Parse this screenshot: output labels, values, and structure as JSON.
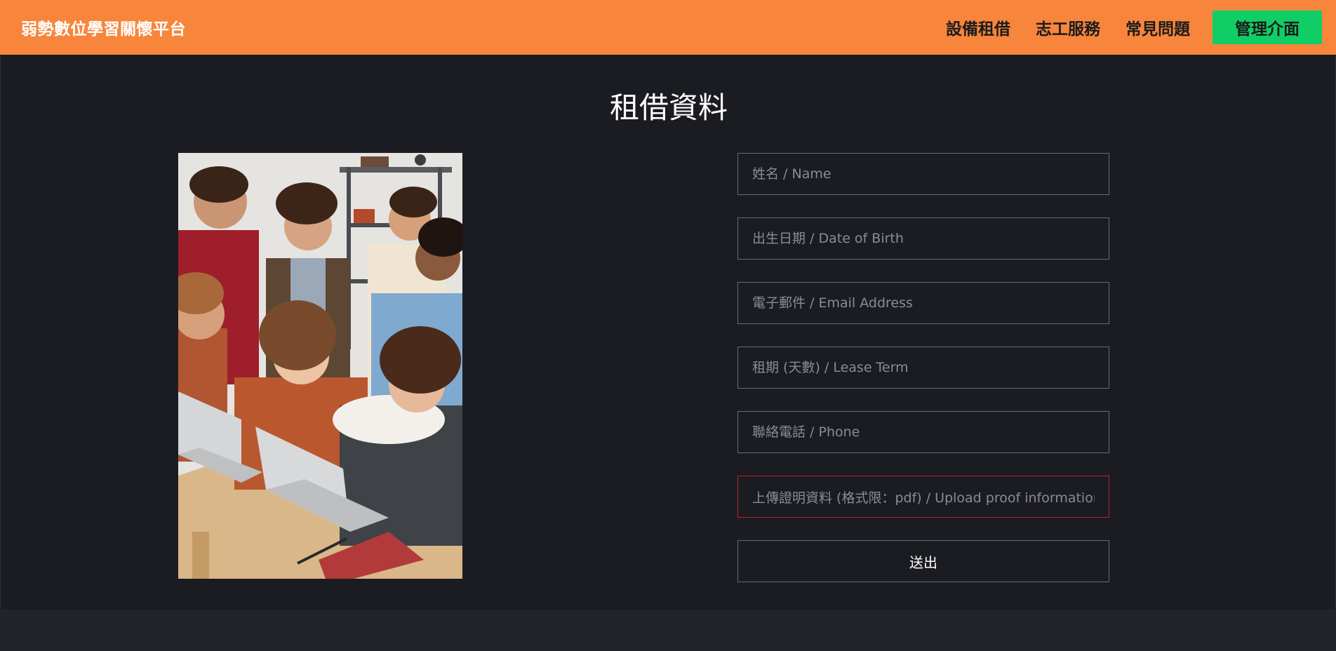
{
  "navbar": {
    "brand": "弱勢數位學習關懷平台",
    "links": [
      "設備租借",
      "志工服務",
      "常見問題"
    ],
    "admin_label": "管理介面"
  },
  "main": {
    "title": "租借資料",
    "form": {
      "name_placeholder": "姓名 / Name",
      "dob_placeholder": "出生日期 / Date of Birth",
      "email_placeholder": "電子郵件 / Email Address",
      "lease_placeholder": "租期 (天數) / Lease Term",
      "phone_placeholder": "聯絡電話 / Phone",
      "upload_label": "上傳證明資料 (格式限：pdf) / Upload proof information (",
      "submit_label": "送出"
    }
  },
  "colors": {
    "navbar": "#f7853c",
    "admin_button": "#0fce66",
    "background": "#1b1c22",
    "invalid_border": "#c01f2a"
  }
}
